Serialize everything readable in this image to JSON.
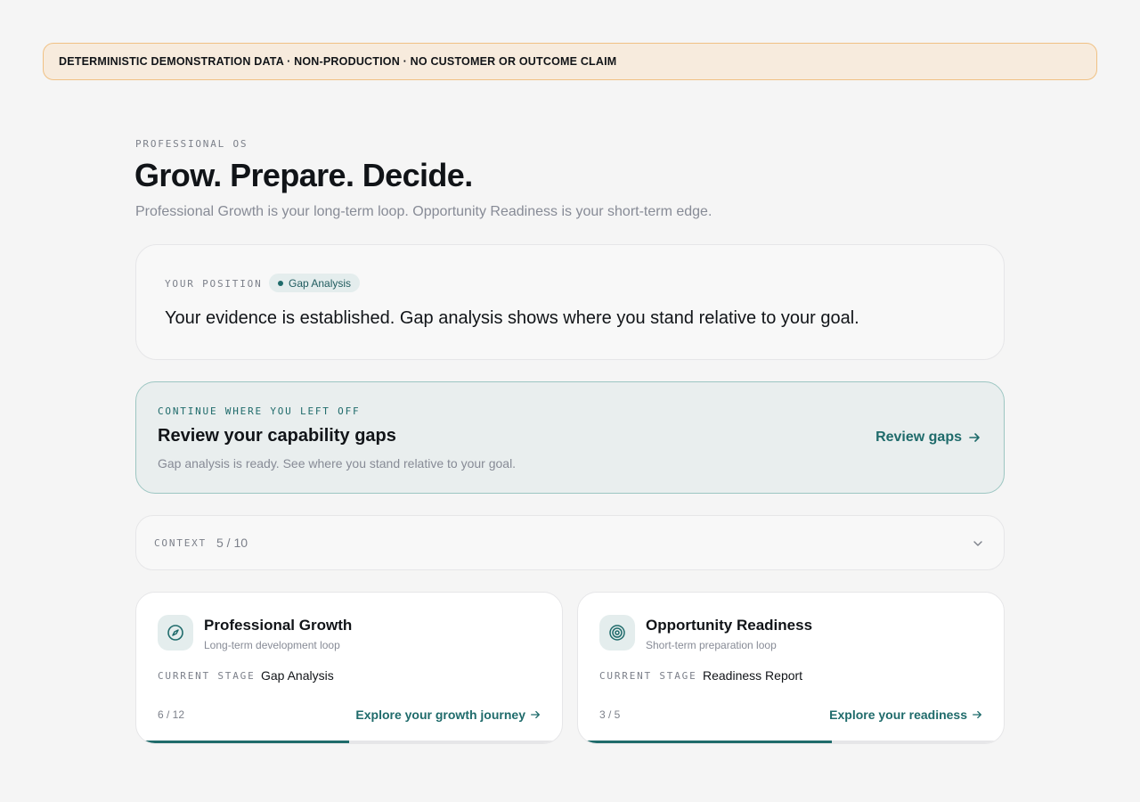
{
  "banner": {
    "text": "DETERMINISTIC DEMONSTRATION DATA · NON-PRODUCTION · NO CUSTOMER OR OUTCOME CLAIM"
  },
  "header": {
    "eyebrow": "PROFESSIONAL OS",
    "title": "Grow. Prepare. Decide.",
    "subtitle": "Professional Growth is your long-term loop. Opportunity Readiness is your short-term edge."
  },
  "position": {
    "label": "YOUR POSITION",
    "chip": "Gap Analysis",
    "text": "Your evidence is established. Gap analysis shows where you stand relative to your goal."
  },
  "continue": {
    "label": "CONTINUE WHERE YOU LEFT OFF",
    "title": "Review your capability gaps",
    "description": "Gap analysis is ready. See where you stand relative to your goal.",
    "action": "Review gaps"
  },
  "context": {
    "label": "CONTEXT",
    "value": "5 / 10",
    "icon": "chevron-down-icon"
  },
  "loops": [
    {
      "icon": "compass-icon",
      "title": "Professional Growth",
      "subtitle": "Long-term development loop",
      "stage_label": "CURRENT STAGE",
      "stage": "Gap Analysis",
      "count": "6 / 12",
      "progress": 0.5,
      "action": "Explore your growth journey"
    },
    {
      "icon": "target-icon",
      "title": "Opportunity Readiness",
      "subtitle": "Short-term preparation loop",
      "stage_label": "CURRENT STAGE",
      "stage": "Readiness Report",
      "count": "3 / 5",
      "progress": 0.6,
      "action": "Explore your readiness"
    }
  ],
  "colors": {
    "accent": "#1f6b6b",
    "banner_bg": "#f7ebdd",
    "banner_border": "#f0c184"
  }
}
